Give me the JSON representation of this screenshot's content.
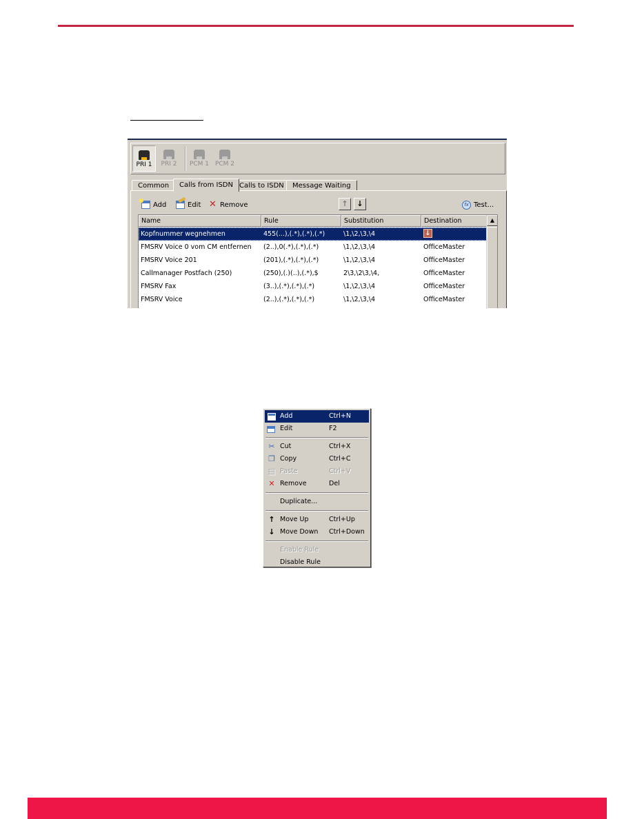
{
  "colors": {
    "accent_line": "#c8243f",
    "accent_bar": "#ee1646",
    "selection": "#0a246a"
  },
  "dialog": {
    "ports": [
      {
        "label": "PRI 1",
        "active": true
      },
      {
        "label": "PRI 2",
        "active": false
      },
      {
        "label": "PCM 1",
        "active": false
      },
      {
        "label": "PCM 2",
        "active": false
      }
    ],
    "tabs": [
      {
        "label": "Common",
        "active": false
      },
      {
        "label": "Calls from ISDN",
        "active": true
      },
      {
        "label": "Calls to ISDN",
        "active": false
      },
      {
        "label": "Message Waiting",
        "active": false
      }
    ],
    "toolbar": {
      "add_label": "Add",
      "edit_label": "Edit",
      "remove_label": "Remove",
      "move_up_icon": "↑",
      "move_down_icon": "↓",
      "test_label": "Test..."
    },
    "grid": {
      "columns": [
        "Name",
        "Rule",
        "Substitution",
        "Destination"
      ],
      "rows": [
        {
          "name": "Kopfnummer wegnehmen",
          "rule": "455(...),(.*),(.*),(.*)",
          "substitution": "\\1,\\2,\\3,\\4",
          "destination": "",
          "destination_icon": "down-arrow-icon",
          "selected": true
        },
        {
          "name": "FMSRV Voice 0 vom CM entfernen",
          "rule": "(2..),0(.*),(.*),(.*)",
          "substitution": "\\1,\\2,\\3,\\4",
          "destination": "OfficeMaster",
          "selected": false
        },
        {
          "name": "FMSRV Voice 201",
          "rule": "(201),(.*),(.*),(.*)",
          "substitution": "\\1,\\2,\\3,\\4",
          "destination": "OfficeMaster",
          "selected": false
        },
        {
          "name": "Callmanager Postfach (250)",
          "rule": "(250),(.)(..),(.*),$",
          "substitution": "2\\3,\\2\\3,\\4,",
          "destination": "OfficeMaster",
          "selected": false
        },
        {
          "name": "FMSRV Fax",
          "rule": "(3..),(.*),(.*),(.*)",
          "substitution": "\\1,\\2,\\3,\\4",
          "destination": "OfficeMaster",
          "selected": false
        },
        {
          "name": "FMSRV Voice",
          "rule": "(2..),(.*),(.*),(.*)",
          "substitution": "\\1,\\2,\\3,\\4",
          "destination": "OfficeMaster",
          "selected": false
        }
      ]
    }
  },
  "context_menu": {
    "items": [
      {
        "label": "Add",
        "shortcut": "Ctrl+N",
        "icon": "new-item-icon",
        "highlighted": true,
        "disabled": false
      },
      {
        "label": "Edit",
        "shortcut": "F2",
        "icon": "edit-icon",
        "highlighted": false,
        "disabled": false
      },
      {
        "label": "Cut",
        "shortcut": "Ctrl+X",
        "icon": "scissors-icon",
        "highlighted": false,
        "disabled": false
      },
      {
        "label": "Copy",
        "shortcut": "Ctrl+C",
        "icon": "copy-icon",
        "highlighted": false,
        "disabled": false
      },
      {
        "label": "Paste",
        "shortcut": "Ctrl+V",
        "icon": "paste-icon",
        "highlighted": false,
        "disabled": true
      },
      {
        "label": "Remove",
        "shortcut": "Del",
        "icon": "remove-icon",
        "highlighted": false,
        "disabled": false
      },
      {
        "label": "Duplicate...",
        "shortcut": "",
        "icon": "",
        "highlighted": false,
        "disabled": false
      },
      {
        "label": "Move Up",
        "shortcut": "Ctrl+Up",
        "icon": "arrow-up-icon",
        "highlighted": false,
        "disabled": false
      },
      {
        "label": "Move Down",
        "shortcut": "Ctrl+Down",
        "icon": "arrow-down-icon",
        "highlighted": false,
        "disabled": false
      },
      {
        "label": "Enable Rule",
        "shortcut": "",
        "icon": "",
        "highlighted": false,
        "disabled": true
      },
      {
        "label": "Disable Rule",
        "shortcut": "",
        "icon": "",
        "highlighted": false,
        "disabled": false
      }
    ]
  }
}
